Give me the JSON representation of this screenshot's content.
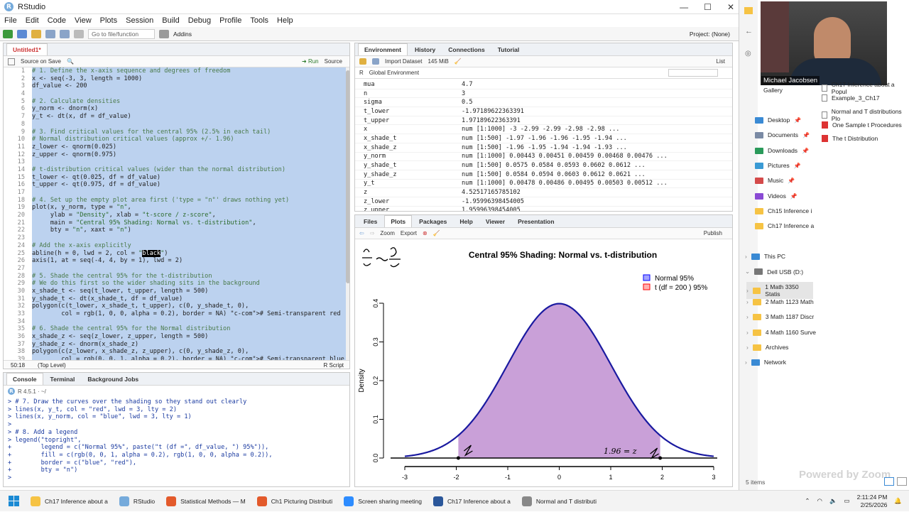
{
  "app": {
    "title": "RStudio",
    "logo": "R"
  },
  "window_controls": [
    "—",
    "☐",
    "✕"
  ],
  "menu": [
    "File",
    "Edit",
    "Code",
    "View",
    "Plots",
    "Session",
    "Build",
    "Debug",
    "Profile",
    "Tools",
    "Help"
  ],
  "toolbar": {
    "goto_placeholder": "Go to file/function",
    "addins": "Addins",
    "project": "Project: (None)"
  },
  "editor": {
    "tab": "Untitled1*",
    "source_on_save": "Source on Save",
    "run": "Run",
    "source": "Source",
    "status_pos": "50:18",
    "status_level": "(Top Level)",
    "status_type": "R Script",
    "line_numbers": [
      "1",
      "2",
      "3",
      "4",
      "5",
      "6",
      "7",
      "8",
      "9",
      "10",
      "11",
      "12",
      "13",
      "14",
      "15",
      "16",
      "17",
      "18",
      "19",
      "20",
      "21",
      "22",
      "23",
      "24",
      "25",
      "26",
      "27",
      "28",
      "29",
      "30",
      "31",
      "32",
      "33",
      "34",
      "35",
      "36",
      "37",
      "38",
      "39"
    ],
    "lines": [
      "# 1. Define the x-axis sequence and degrees of freedom",
      "x <- seq(-3, 3, length = 1000)",
      "df_value <- 200",
      "",
      "# 2. Calculate densities",
      "y_norm <- dnorm(x)",
      "y_t <- dt(x, df = df_value)",
      "",
      "# 3. Find critical values for the central 95% (2.5% in each tail)",
      "# Normal distribution critical values (approx +/- 1.96)",
      "z_lower <- qnorm(0.025)",
      "z_upper <- qnorm(0.975)",
      "",
      "# t-distribution critical values (wider than the normal distribution)",
      "t_lower <- qt(0.025, df = df_value)",
      "t_upper <- qt(0.975, df = df_value)",
      "",
      "# 4. Set up the empty plot area first ('type = \"n\"' draws nothing yet)",
      "plot(x, y_norm, type = \"n\",",
      "     ylab = \"Density\", xlab = \"t-score / z-score\",",
      "     main = \"Central 95% Shading: Normal vs. t-distribution\",",
      "     bty = \"n\", xaxt = \"n\")",
      "",
      "# Add the x-axis explicitly",
      "abline(h = 0, lwd = 2, col = \"black\")",
      "axis(1, at = seq(-4, 4, by = 1), lwd = 2)",
      "",
      "# 5. Shade the central 95% for the t-distribution",
      "# We do this first so the wider shading sits in the background",
      "x_shade_t <- seq(t_lower, t_upper, length = 500)",
      "y_shade_t <- dt(x_shade_t, df = df_value)",
      "polygon(c(t_lower, x_shade_t, t_upper), c(0, y_shade_t, 0),",
      "        col = rgb(1, 0, 0, alpha = 0.2), border = NA) # Semi-transparent red",
      "",
      "# 6. Shade the central 95% for the Normal distribution",
      "x_shade_z <- seq(z_lower, z_upper, length = 500)",
      "y_shade_z <- dnorm(x_shade_z)",
      "polygon(c(z_lower, x_shade_z, z_upper), c(0, y_shade_z, 0),",
      "        col = rgb(0, 0, 1, alpha = 0.2), border = NA) # Semi-transparent blue"
    ]
  },
  "console": {
    "tabs": [
      "Console",
      "Terminal",
      "Background Jobs"
    ],
    "version": "R 4.5.1 · ~/",
    "lines": [
      "> # 7. Draw the curves over the shading so they stand out clearly",
      "> lines(x, y_t, col = \"red\", lwd = 3, lty = 2)",
      "> lines(x, y_norm, col = \"blue\", lwd = 3, lty = 1)",
      ">",
      "> # 8. Add a legend",
      "> legend(\"topright\",",
      "+        legend = c(\"Normal 95%\", paste(\"t (df =\", df_value, \") 95%\")),",
      "+        fill = c(rgb(0, 0, 1, alpha = 0.2), rgb(1, 0, 0, alpha = 0.2)),",
      "+        border = c(\"blue\", \"red\"),",
      "+        bty = \"n\")",
      ">"
    ]
  },
  "environment": {
    "tabs": [
      "Environment",
      "History",
      "Connections",
      "Tutorial"
    ],
    "import": "Import Dataset",
    "memory": "145 MiB",
    "list": "List",
    "scope": "Global Environment",
    "rows": [
      {
        "name": "mua",
        "value": "4.7"
      },
      {
        "name": "n",
        "value": "3"
      },
      {
        "name": "sigma",
        "value": "0.5"
      },
      {
        "name": "t_lower",
        "value": "-1.97189622363391"
      },
      {
        "name": "t_upper",
        "value": "1.97189622363391"
      },
      {
        "name": "x",
        "value": "num [1:1000] -3 -2.99 -2.99 -2.98 -2.98 ..."
      },
      {
        "name": "x_shade_t",
        "value": "num [1:500] -1.97 -1.96 -1.96 -1.95 -1.94 ..."
      },
      {
        "name": "x_shade_z",
        "value": "num [1:500] -1.96 -1.95 -1.94 -1.94 -1.93 ..."
      },
      {
        "name": "y_norm",
        "value": "num [1:1000] 0.00443 0.00451 0.00459 0.00468 0.00476 ..."
      },
      {
        "name": "y_shade_t",
        "value": "num [1:500] 0.0575 0.0584 0.0593 0.0602 0.0612 ..."
      },
      {
        "name": "y_shade_z",
        "value": "num [1:500] 0.0584 0.0594 0.0603 0.0612 0.0621 ..."
      },
      {
        "name": "y_t",
        "value": "num [1:1000] 0.00478 0.00486 0.00495 0.00503 0.00512 ..."
      },
      {
        "name": "z",
        "value": "4.52517165785102"
      },
      {
        "name": "z_lower",
        "value": "-1.95996398454005"
      },
      {
        "name": "z_upper",
        "value": "1.95996398454005"
      }
    ]
  },
  "plots": {
    "tabs": [
      "Files",
      "Plots",
      "Packages",
      "Help",
      "Viewer",
      "Presentation"
    ],
    "zoom": "Zoom",
    "export": "Export",
    "publish": "Publish"
  },
  "chart_data": {
    "type": "area",
    "title": "Central 95% Shading: Normal vs. t-distribution",
    "xlabel": "t-score / z-score",
    "ylabel": "Density",
    "xlim": [
      -3,
      3
    ],
    "ylim": [
      0,
      0.4
    ],
    "x_ticks": [
      "-3",
      "-2",
      "-1",
      "0",
      "1",
      "2",
      "3"
    ],
    "y_ticks": [
      "0.0",
      "0.1",
      "0.2",
      "0.3",
      "0.4"
    ],
    "legend": [
      {
        "name": "Normal 95%",
        "fill": "#a3a3ff",
        "border": "#0000ff"
      },
      {
        "name": "t (df = 200 ) 95%",
        "fill": "#ffb0b0",
        "border": "#ff0000"
      }
    ],
    "legend_position": "top-right",
    "curve_color": "#1a1aa0",
    "shade_color": "#c9a0d8",
    "shade_range": [
      -1.96,
      1.96
    ],
    "annotations": [
      "1.96 = z"
    ]
  },
  "explorer": {
    "items_top": [
      "Gallery"
    ],
    "recent": [
      "Ch17 Inference about a Popul",
      "Example_3_Ch17",
      "Normal and T distributions Plo",
      "One Sample t Procedures",
      "The t Distribution"
    ],
    "quick": [
      "Desktop",
      "Documents",
      "Downloads",
      "Pictures",
      "Music",
      "Videos",
      "Ch15 Inference i",
      "Ch17 Inference a"
    ],
    "this_pc": "This PC",
    "usb": "Dell USB (D:)",
    "usb_items": [
      "1 Math 3350 Statis",
      "2 Math 1123 Math",
      "3 Math 1187 Discr",
      "4 Math 1160 Surve",
      "Archives"
    ],
    "network": "Network",
    "count": "5 items"
  },
  "webcam": {
    "name": "Michael Jacobsen"
  },
  "zoom_watermark": "Powered by Zoom",
  "taskbar": {
    "apps": [
      {
        "label": "Ch17 Inference about a",
        "color": "#f6c344"
      },
      {
        "label": "RStudio",
        "color": "#75aadb"
      },
      {
        "label": "Statistical Methods — M",
        "color": "#e35a2b"
      },
      {
        "label": "Ch1 Picturing Distributi",
        "color": "#e35a2b"
      },
      {
        "label": "Screen sharing meeting",
        "color": "#2d8cff"
      },
      {
        "label": "Ch17 Inference about a",
        "color": "#2b579a"
      },
      {
        "label": "Normal and T distributi",
        "color": "#888888"
      }
    ],
    "time": "2:11:24 PM",
    "date": "2/25/2026"
  }
}
